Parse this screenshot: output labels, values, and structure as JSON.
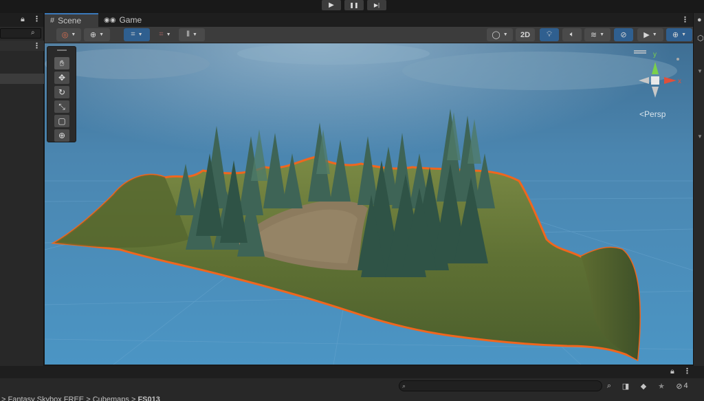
{
  "play_controls": {
    "play": "▶",
    "pause": "❚❚",
    "step": "▶|"
  },
  "tabs": {
    "scene": "Scene",
    "game": "Game"
  },
  "toolbar": {
    "mode_2d": "2D"
  },
  "scene": {
    "view_label": "Persp",
    "gizmo_y": "y",
    "gizmo_x": "x"
  },
  "bottom": {
    "hidden_count": "4",
    "breadcrumb": [
      "Fantasy Skybox FREE",
      "Cubemaps",
      "FS013"
    ]
  },
  "colors": {
    "accent": "#3a79bb",
    "selection_outline": "#f0661e",
    "sky_top": "#2d5a80",
    "grass": "#6b7a3a"
  }
}
